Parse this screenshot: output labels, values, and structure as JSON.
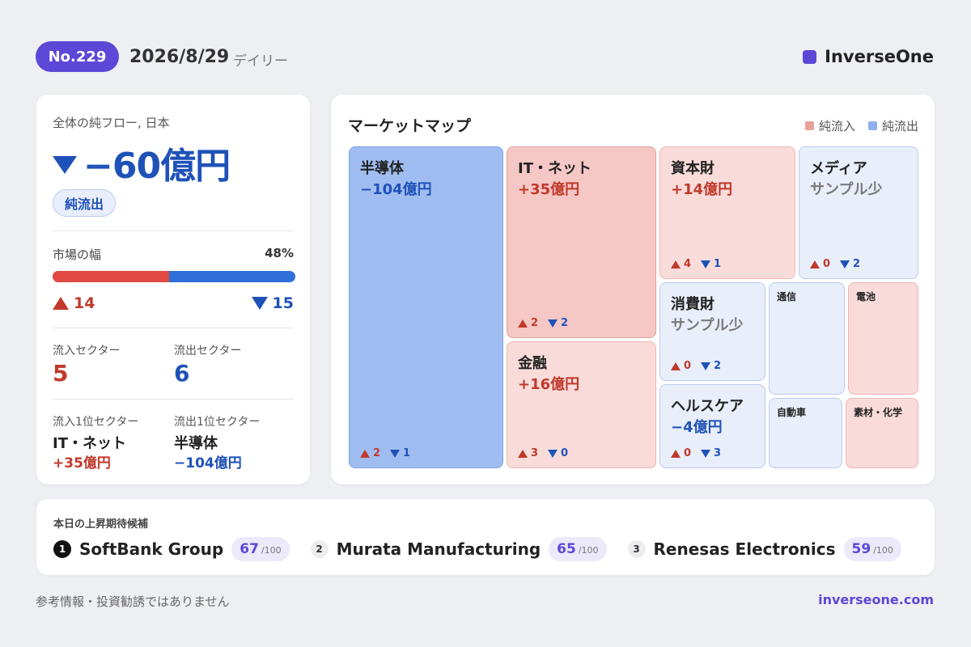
{
  "header": {
    "issue": "No.229",
    "date": "2026/8/29",
    "frequency": "デイリー",
    "brand": "InverseOne"
  },
  "summary": {
    "label": "全体の純フロー, 日本",
    "total": "−60億円",
    "direction": "純流出",
    "breadth_label": "市場の幅",
    "breadth_pct": "48%",
    "breadth_fraction": 0.48,
    "up_count": "14",
    "down_count": "15",
    "inflow_sectors_label": "流入セクター",
    "inflow_sectors": "5",
    "outflow_sectors_label": "流出セクター",
    "outflow_sectors": "6",
    "top_inflow_label": "流入1位セクター",
    "top_inflow_name": "IT・ネット",
    "top_inflow_value": "+35億円",
    "top_outflow_label": "流出1位セクター",
    "top_outflow_name": "半導体",
    "top_outflow_value": "−104億円"
  },
  "market_map": {
    "title": "マーケットマップ",
    "legend_in": "純流入",
    "legend_out": "純流出",
    "colors": {
      "in": "#e8a09c",
      "out": "#8fb0ee"
    },
    "tiles": [
      {
        "name": "半導体",
        "value": "−104億円",
        "up": "2",
        "down": "1"
      },
      {
        "name": "IT・ネット",
        "value": "+35億円",
        "up": "2",
        "down": "2"
      },
      {
        "name": "金融",
        "value": "+16億円",
        "up": "3",
        "down": "0"
      },
      {
        "name": "資本財",
        "value": "+14億円",
        "up": "4",
        "down": "1"
      },
      {
        "name": "メディア",
        "value": "サンプル少",
        "up": "0",
        "down": "2"
      },
      {
        "name": "消費財",
        "value": "サンプル少",
        "up": "0",
        "down": "2"
      },
      {
        "name": "ヘルスケア",
        "value": "−4億円",
        "up": "0",
        "down": "3"
      },
      {
        "name": "通信"
      },
      {
        "name": "電池"
      },
      {
        "name": "自動車"
      },
      {
        "name": "素材・化学"
      }
    ]
  },
  "candidates": {
    "title": "本日の上昇期待候補",
    "items": [
      {
        "rank": "1",
        "name": "SoftBank Group",
        "score": "67",
        "max": "/100"
      },
      {
        "rank": "2",
        "name": "Murata Manufacturing",
        "score": "65",
        "max": "/100"
      },
      {
        "rank": "3",
        "name": "Renesas Electronics",
        "score": "59",
        "max": "/100"
      }
    ]
  },
  "footer": {
    "disclaimer": "参考情報・投資勧誘ではありません",
    "url": "inverseone.com"
  }
}
